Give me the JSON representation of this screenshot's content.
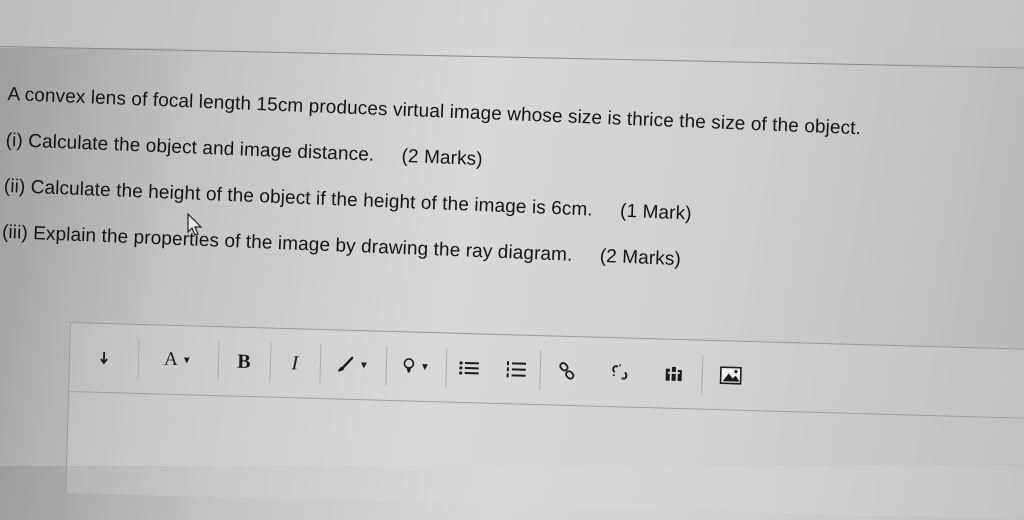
{
  "question": {
    "line1": "A convex lens of focal length 15cm produces virtual image whose size is thrice the size of the object.",
    "line2": "(i) Calculate the object and image distance.",
    "line2_marks": "(2 Marks)",
    "line3": "(ii) Calculate the height of the object if the height of the image is 6cm.",
    "line3_marks": "(1 Mark)",
    "line4": "(iii) Explain the properties of the image by drawing the ray diagram.",
    "line4_marks": "(2 Marks)"
  },
  "toolbar": {
    "font_size_label": "A",
    "bold_label": "B",
    "italic_label": "I",
    "icons": [
      "paragraph-icon",
      "font-size-icon",
      "bold-icon",
      "italic-icon",
      "text-color-icon",
      "highlight-icon",
      "bullet-list-icon",
      "numbered-list-icon",
      "link-icon",
      "unlink-icon",
      "media-icon",
      "image-icon"
    ]
  }
}
